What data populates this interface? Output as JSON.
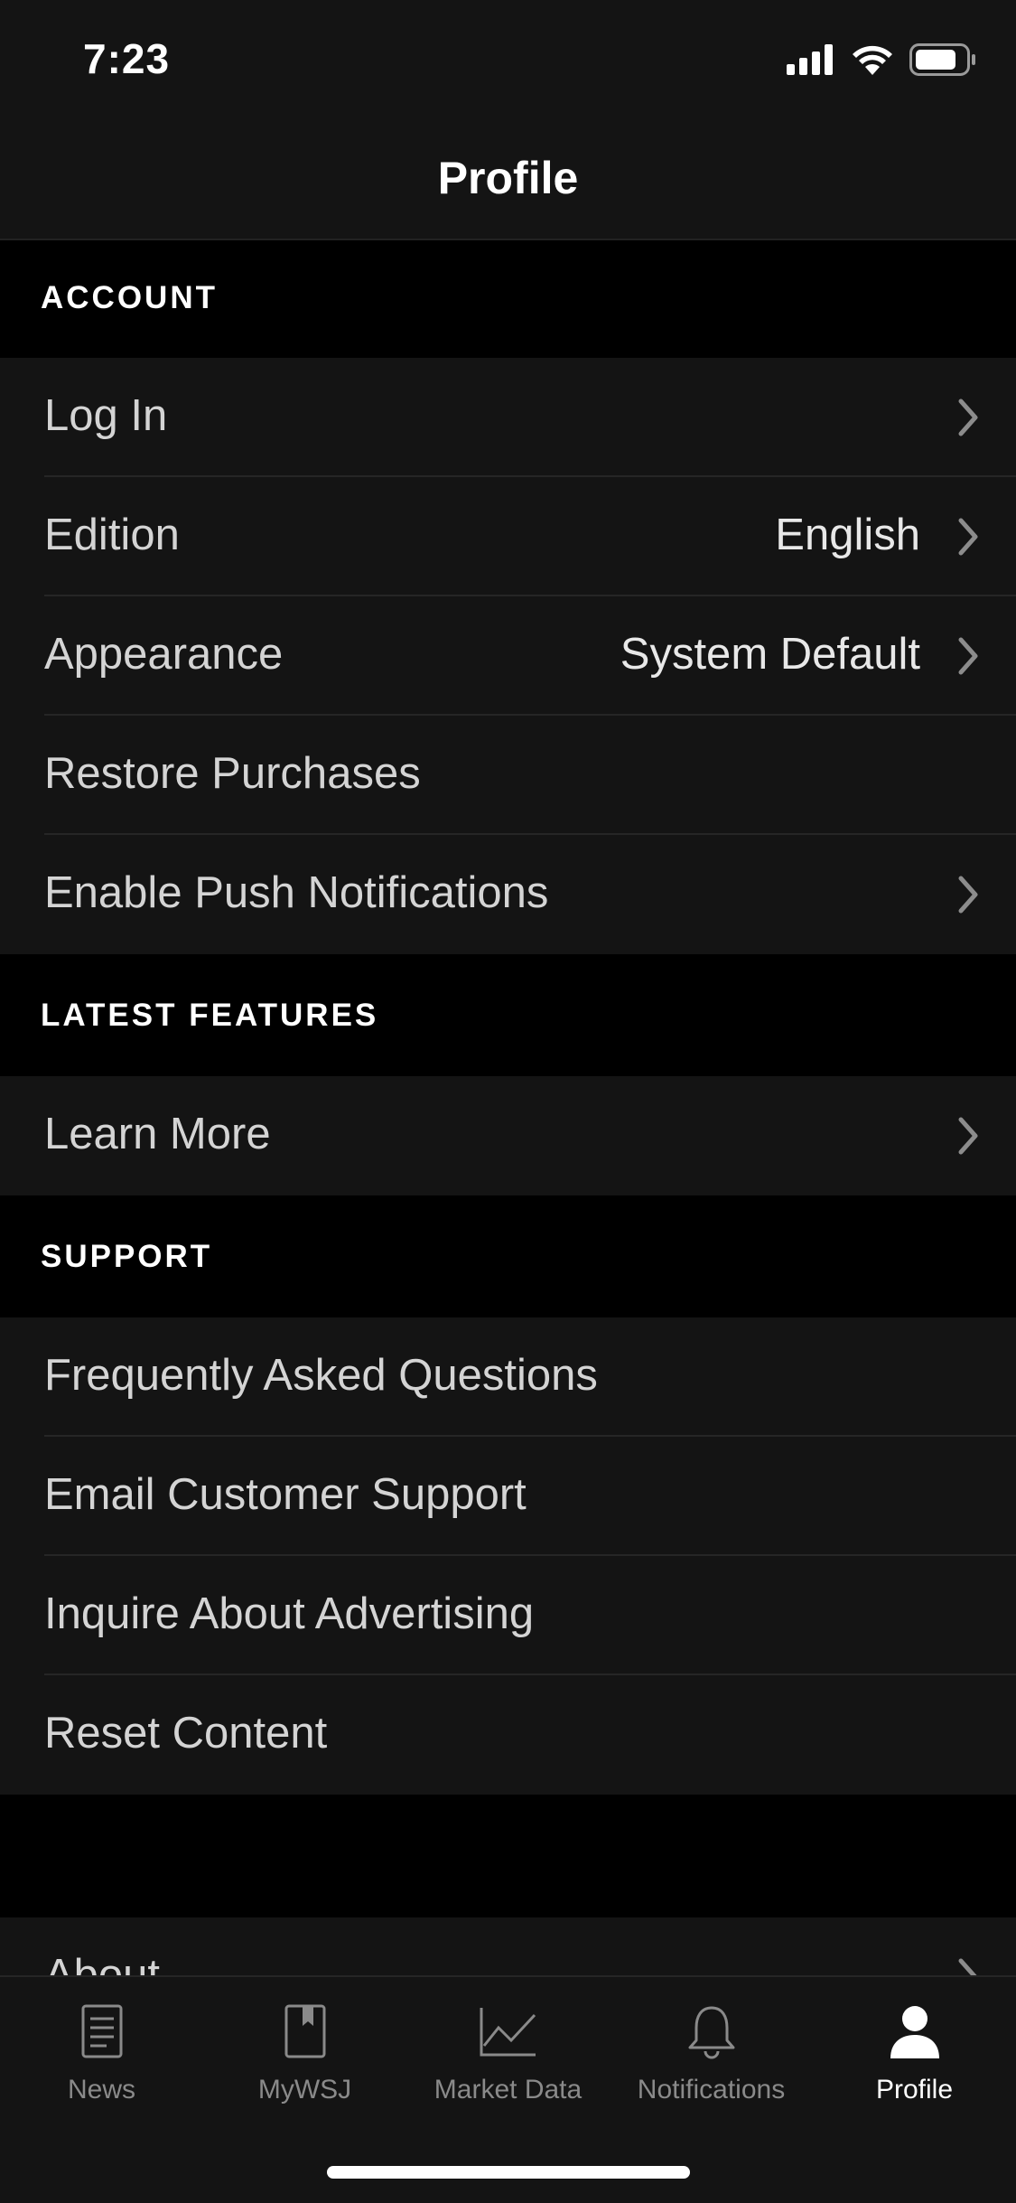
{
  "status_bar": {
    "time": "7:23"
  },
  "header": {
    "title": "Profile"
  },
  "sections": {
    "account": {
      "label": "ACCOUNT",
      "items": {
        "login": {
          "label": "Log In"
        },
        "edition": {
          "label": "Edition",
          "value": "English"
        },
        "appearance": {
          "label": "Appearance",
          "value": "System Default"
        },
        "restore": {
          "label": "Restore Purchases"
        },
        "push": {
          "label": "Enable Push Notifications"
        }
      }
    },
    "latest_features": {
      "label": "LATEST FEATURES",
      "items": {
        "learn_more": {
          "label": "Learn More"
        }
      }
    },
    "support": {
      "label": "SUPPORT",
      "items": {
        "faq": {
          "label": "Frequently Asked Questions"
        },
        "email": {
          "label": "Email Customer Support"
        },
        "advertising": {
          "label": "Inquire About Advertising"
        },
        "reset": {
          "label": "Reset Content"
        }
      }
    },
    "about": {
      "label": "About"
    }
  },
  "tabs": {
    "news": "News",
    "mywsj": "MyWSJ",
    "market_data": "Market Data",
    "notifications": "Notifications",
    "profile": "Profile"
  },
  "colors": {
    "background": "#000000",
    "row_background": "#141414",
    "text": "#d4d4d4",
    "active_tab": "#ffffff",
    "inactive_tab": "#8a8a8a"
  }
}
